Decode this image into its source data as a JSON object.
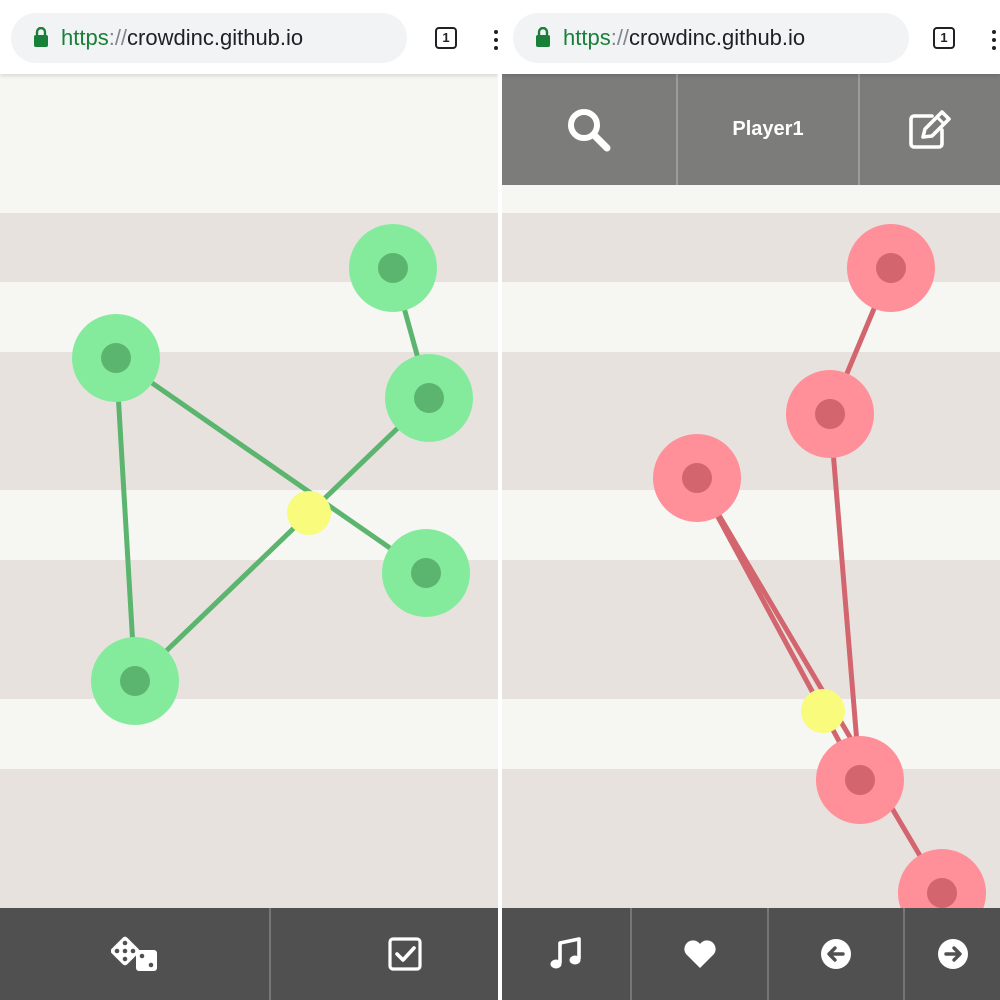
{
  "browser": {
    "url_scheme": "https",
    "url_separator": "://",
    "url_host": "crowdinc.github.io",
    "tab_count": "1"
  },
  "left_panel": {
    "node_color": "#85eb9c",
    "node_core_color": "#5cb56f",
    "edge_color": "#5cb56f",
    "toolbar": [
      "dice-icon",
      "checkbox-checked-icon"
    ]
  },
  "right_panel": {
    "player_name": "Player1",
    "node_color": "#ff8f98",
    "node_core_color": "#d2656e",
    "edge_color": "#d2656e",
    "topbar": [
      "search-icon",
      "Player1",
      "edit-icon"
    ],
    "toolbar": [
      "music-note-icon",
      "heart-icon",
      "arrow-left-circle-icon",
      "arrow-right-circle-icon"
    ]
  },
  "intersection_color": "#f9fb7c",
  "stripe_color": "#e8e2df",
  "background_color": "#f6f6f3"
}
